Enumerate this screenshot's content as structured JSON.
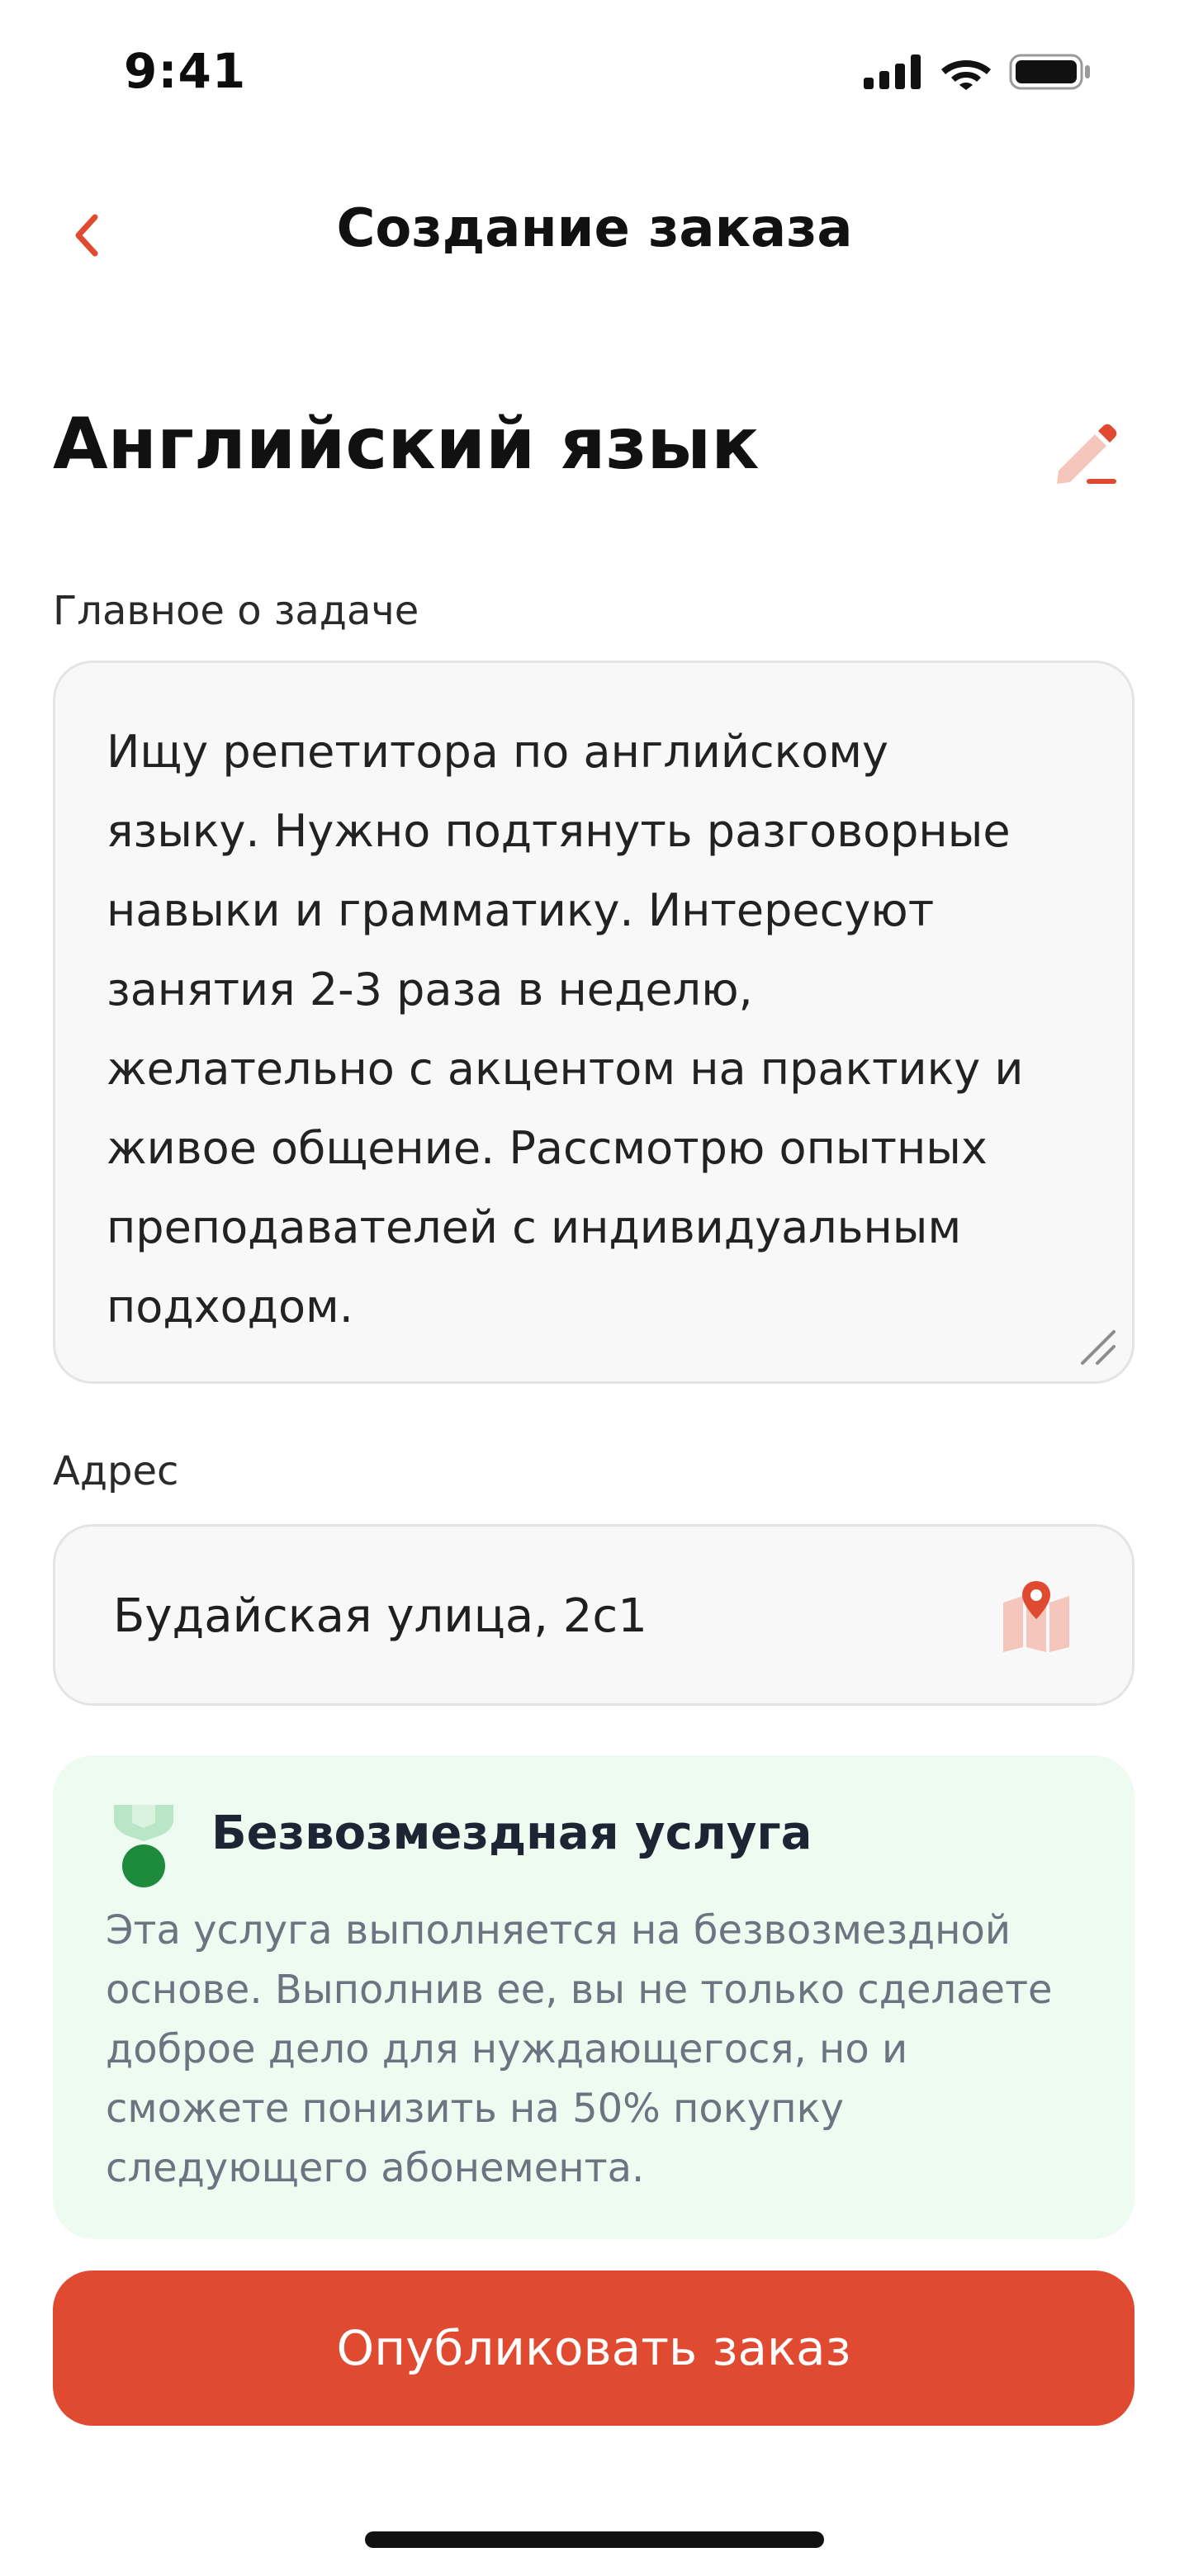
{
  "status_bar": {
    "time": "9:41",
    "icons": [
      "signal-icon",
      "wifi-icon",
      "battery-icon"
    ]
  },
  "header": {
    "title": "Создание заказа",
    "back_icon": "chevron-left-icon"
  },
  "subject": {
    "title": "Английский язык",
    "edit_icon": "pencil-icon"
  },
  "task": {
    "label": "Главное о задаче",
    "value": "Ищу репетитора по английскому\nязыку. Нужно подтянуть разговорные\nнавыки и грамматику. Интересуют\nзанятия 2-3 раза в неделю,\nжелательно с акцентом на практику и\nживое общение. Рассмотрю опытных\nпреподавателей с индивидуальным\nподходом."
  },
  "address": {
    "label": "Адрес",
    "value": "Будайская улица, 2с1",
    "map_icon": "map-pin-icon"
  },
  "info_card": {
    "icon": "medal-icon",
    "title": "Безвозмездная услуга",
    "text": "Эта услуга выполняется на безвозмездной\nоснове. Выполнив ее, вы не только сделаете\nдоброе дело для нуждающегося, но и\nсможете понизить на 50% покупку\nследующего абонемента."
  },
  "publish_button": {
    "label": "Опубликовать заказ"
  },
  "colors": {
    "accent": "#e04a31",
    "accent_light": "#f5c6bb",
    "info_bg": "#edfbf1",
    "medal_green": "#1e8a3c"
  }
}
